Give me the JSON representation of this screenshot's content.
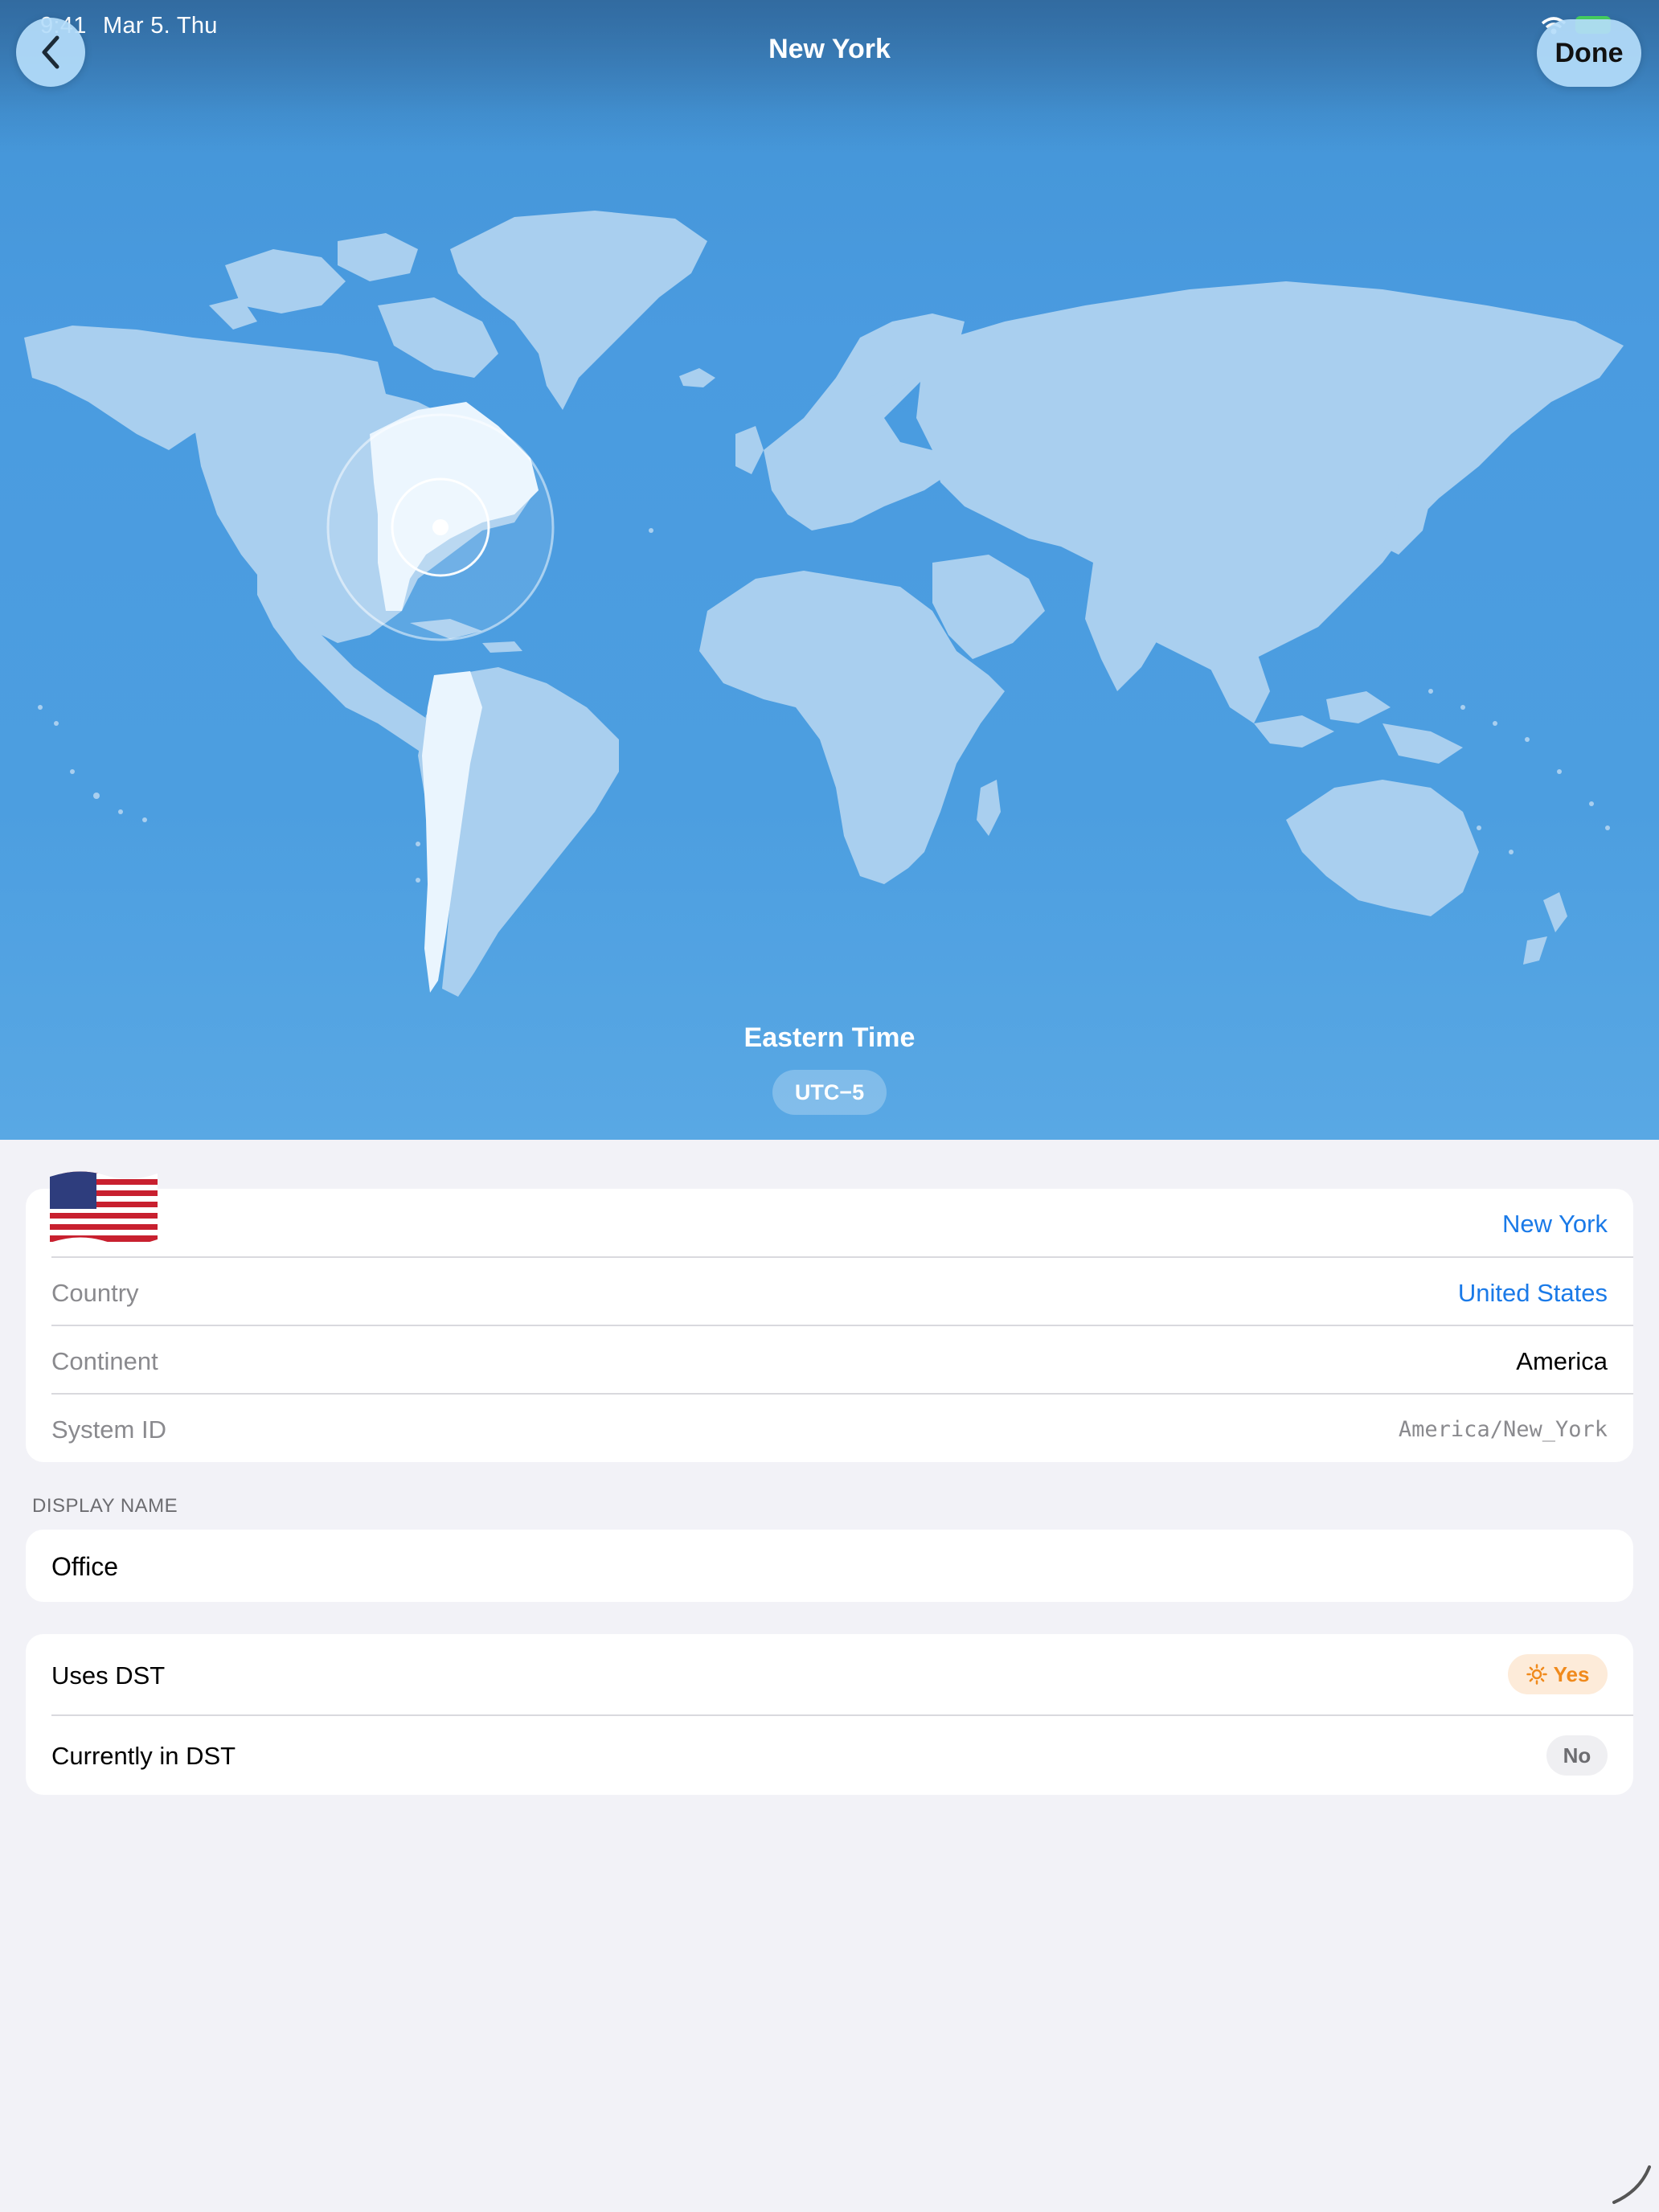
{
  "status_bar": {
    "time": "9:41",
    "date": "Mar 5. Thu"
  },
  "nav": {
    "title": "New York",
    "done_label": "Done",
    "back_icon": "chevron-left-icon"
  },
  "map": {
    "timezone_name": "Eastern Time",
    "utc_offset": "UTC−5",
    "highlight_city": "New York"
  },
  "location_card": {
    "flag_icon": "us-flag-icon",
    "city": "New York",
    "rows": [
      {
        "label": "Country",
        "value": "United States"
      },
      {
        "label": "Continent",
        "value": "America"
      },
      {
        "label": "System ID",
        "value": "America/New_York"
      }
    ]
  },
  "display_name": {
    "header": "DISPLAY NAME",
    "value": "Office"
  },
  "dst_card": {
    "uses_dst_label": "Uses DST",
    "uses_dst_value": "Yes",
    "currently_label": "Currently in DST",
    "currently_value": "No"
  },
  "colors": {
    "accent": "#1a7ae8",
    "map_bg": "#4a9be0",
    "yes_color": "#f08a1c",
    "page_bg": "#f2f2f7"
  }
}
